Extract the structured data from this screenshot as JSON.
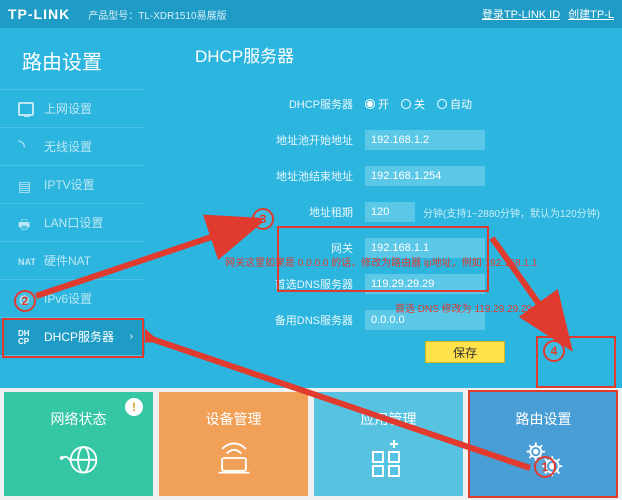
{
  "top": {
    "brand": "TP-LINK",
    "product": "产品型号：TL-XDR1510易展版",
    "link_login": "登录TP-LINK ID",
    "link_create": "创建TP-L"
  },
  "sidebar": {
    "title": "路由设置",
    "items": [
      {
        "label": "上网设置"
      },
      {
        "label": "无线设置"
      },
      {
        "label": "IPTV设置"
      },
      {
        "label": "LAN口设置"
      },
      {
        "label": "硬件NAT"
      },
      {
        "label": "IPv6设置"
      },
      {
        "label": "DHCP服务器"
      }
    ]
  },
  "main": {
    "title": "DHCP服务器",
    "rows": {
      "server_label": "DHCP服务器",
      "radio_on": "开",
      "radio_off": "关",
      "radio_auto": "自动",
      "start_label": "地址池开始地址",
      "start_val": "192.168.1.2",
      "end_label": "地址池结束地址",
      "end_val": "192.168.1.254",
      "lease_label": "地址租期",
      "lease_val": "120",
      "lease_tip": "分钟(支持1~2880分钟，默认为120分钟)",
      "gw_label": "网关",
      "gw_val": "192.168.1.1",
      "dns1_label": "首选DNS服务器",
      "dns1_val": "119.29.29.29",
      "dns2_label": "备用DNS服务器",
      "dns2_val": "0.0.0.0",
      "save": "保存"
    }
  },
  "annotations": {
    "gw_note": "网关这里如果是 0.0.0.0 的话，修改为路由器 ip地址，例如 192.168.1.1",
    "dns_note": "首选 DNS 修改为 119.29.29.29"
  },
  "tiles": [
    {
      "label": "网络状态",
      "badge": "!"
    },
    {
      "label": "设备管理"
    },
    {
      "label": "应用管理"
    },
    {
      "label": "路由设置"
    }
  ]
}
